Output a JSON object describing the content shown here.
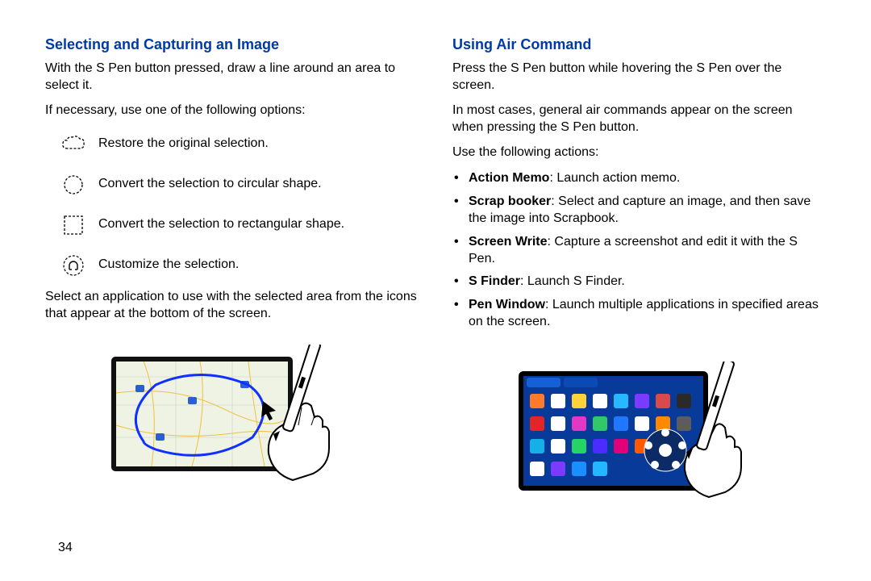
{
  "page_number": "34",
  "left": {
    "heading": "Selecting and Capturing an Image",
    "p1": "With the S Pen button pressed, draw a line around an area to select it.",
    "p2": "If necessary, use one of the following options:",
    "icons": [
      {
        "name": "restore-icon",
        "label": "Restore the original selection."
      },
      {
        "name": "circle-icon",
        "label": "Convert the selection to circular shape."
      },
      {
        "name": "rect-icon",
        "label": "Convert the selection to rectangular shape."
      },
      {
        "name": "magnet-icon",
        "label": "Customize the selection."
      }
    ],
    "p3": "Select an application to use with the selected area from the icons that appear at the bottom of the screen."
  },
  "right": {
    "heading": "Using Air Command",
    "p1": "Press the S Pen button while hovering the S Pen over the screen.",
    "p2": "In most cases, general air commands appear on the screen when pressing the S Pen button.",
    "p3": "Use the following actions:",
    "items": [
      {
        "term": "Action Memo",
        "desc": ": Launch action memo."
      },
      {
        "term": "Scrap booker",
        "desc": ": Select and capture an image, and then save the image into Scrapbook."
      },
      {
        "term": "Screen Write",
        "desc": ": Capture a screenshot and edit it with the S Pen."
      },
      {
        "term": "S Finder",
        "desc": ": Launch S Finder."
      },
      {
        "term": "Pen Window",
        "desc": ": Launch multiple applications in specified areas on the screen."
      }
    ]
  }
}
